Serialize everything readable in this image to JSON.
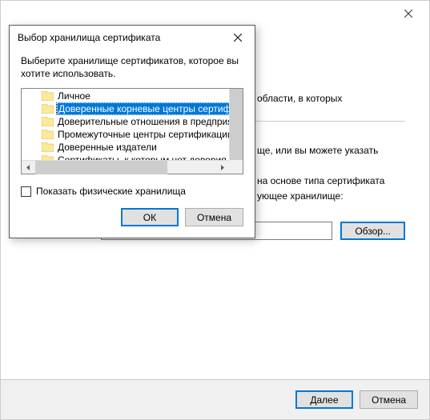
{
  "wizard": {
    "text1": "области, в которых",
    "text2": "ще, или вы можете указать",
    "text3": "на основе типа сертификата",
    "text4": "ующее хранилище:",
    "input_value": "",
    "browse_label": "Обзор...",
    "next_label": "Далее",
    "cancel_label": "Отмена"
  },
  "modal": {
    "title": "Выбор хранилища сертификата",
    "description": "Выберите хранилище сертификатов, которое вы хотите использовать.",
    "tree": {
      "items": [
        {
          "label": "Личное",
          "selected": false
        },
        {
          "label": "Доверенные корневые центры сертификации",
          "selected": true
        },
        {
          "label": "Доверительные отношения в предприятии",
          "selected": false
        },
        {
          "label": "Промежуточные центры сертификации",
          "selected": false
        },
        {
          "label": "Доверенные издатели",
          "selected": false
        },
        {
          "label": "Сертификаты, к которым нет доверия",
          "selected": false
        }
      ]
    },
    "checkbox_label": "Показать физические хранилища",
    "ok_label": "ОК",
    "cancel_label": "Отмена"
  }
}
